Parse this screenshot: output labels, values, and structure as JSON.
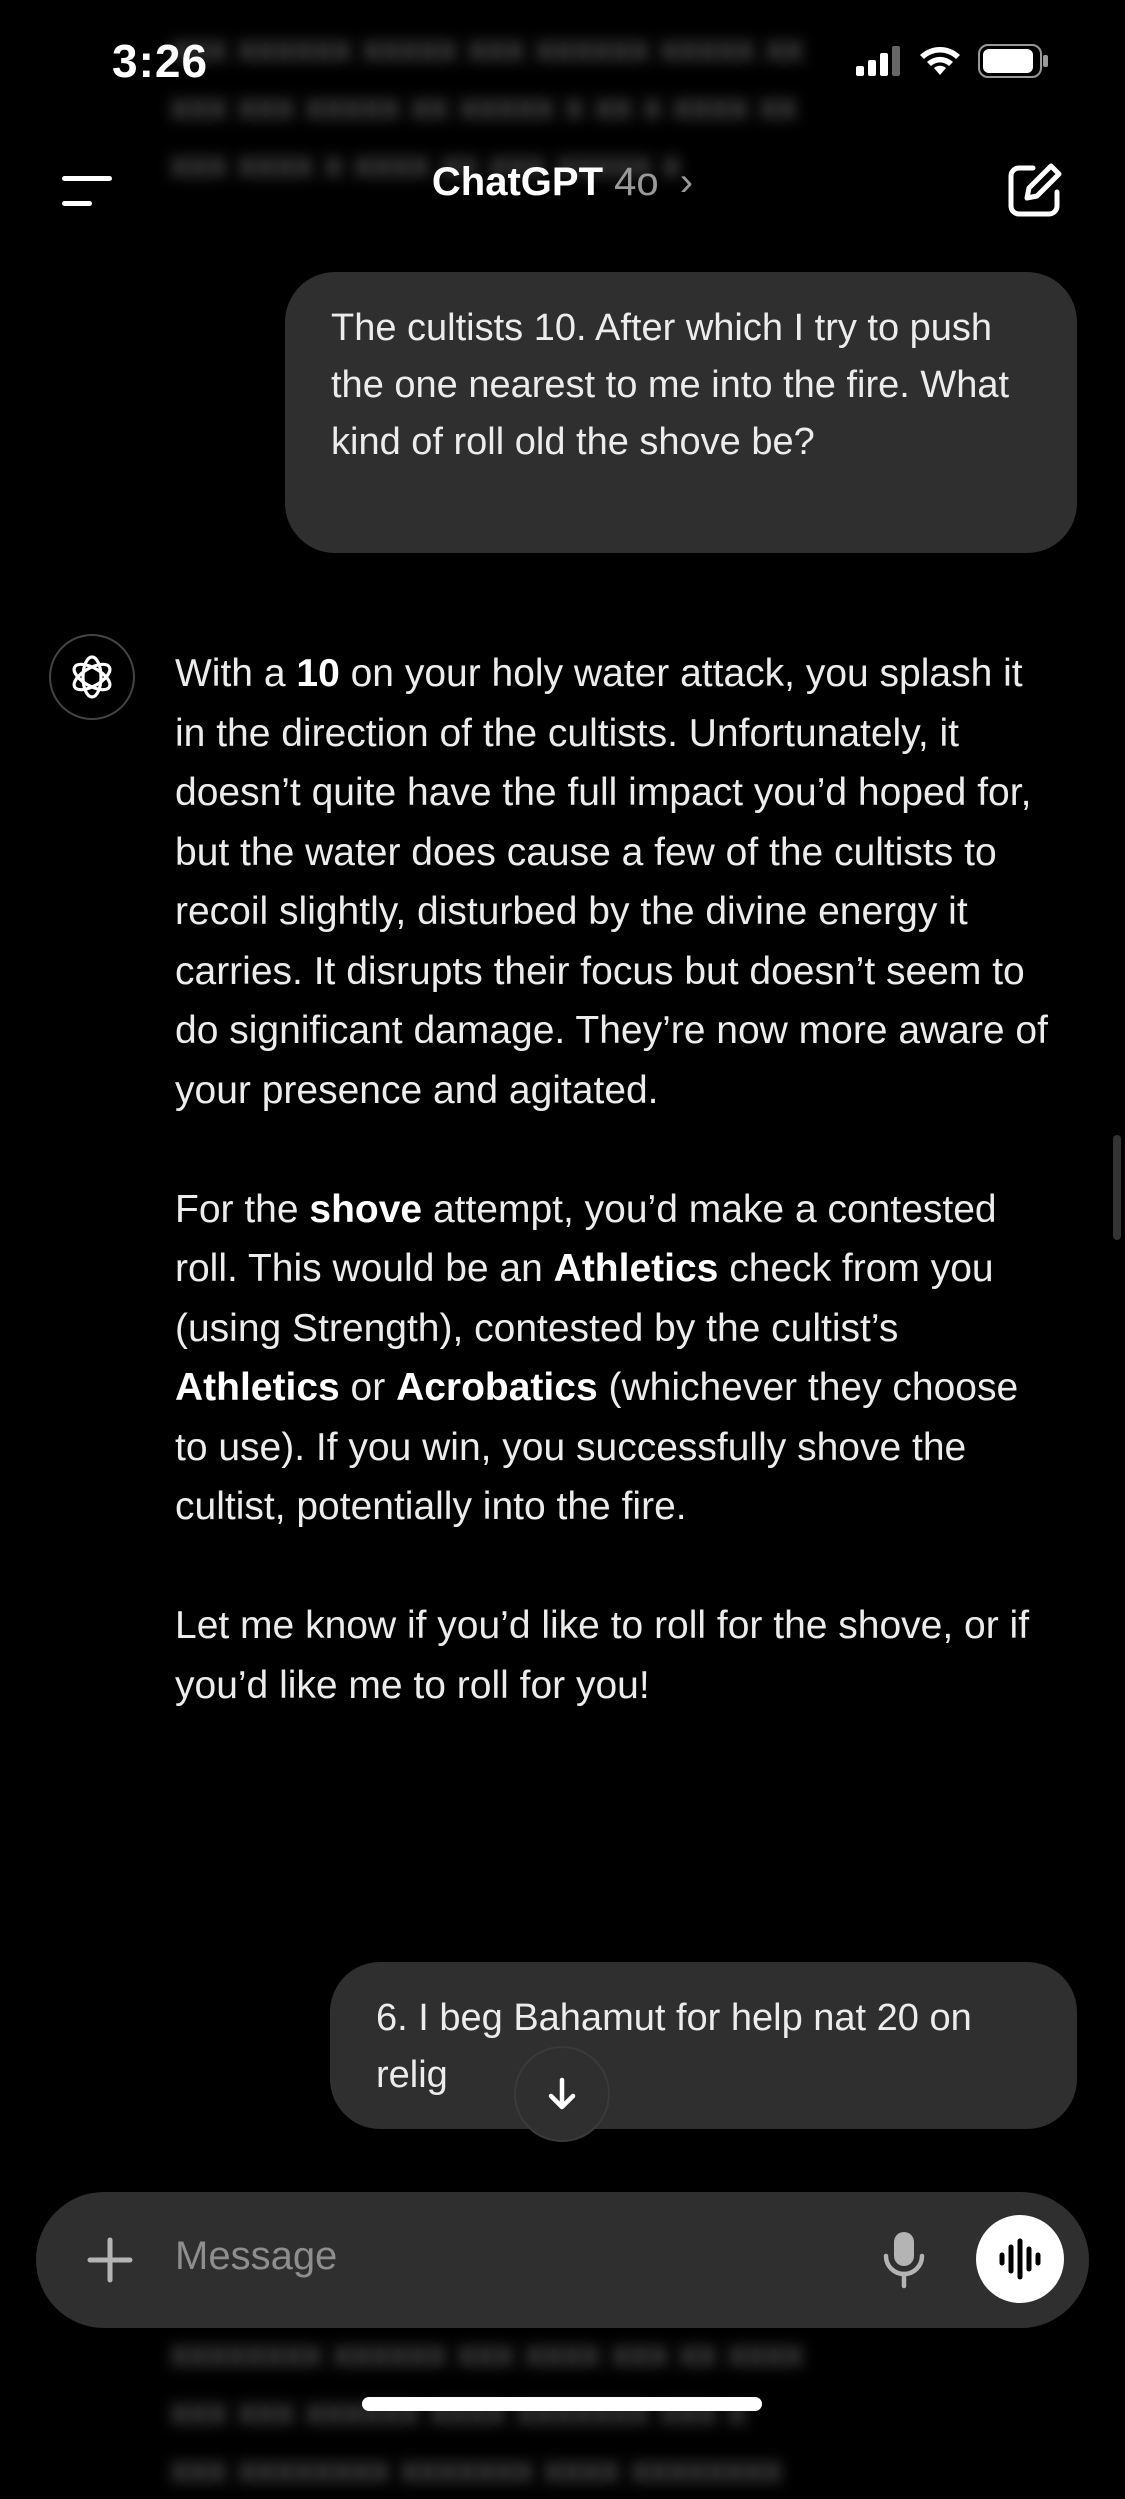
{
  "status": {
    "time": "3:26"
  },
  "header": {
    "title": "ChatGPT",
    "model": "4o",
    "chevron": "›"
  },
  "messages": {
    "user_1": "The cultists 10. After which I try to push the one nearest to me into the fire. What kind of roll old the shove be?",
    "assistant": {
      "p1_a": "With a ",
      "p1_b": "10",
      "p1_c": " on your holy water attack, you splash it in the direction of the cultists. Unfortunately, it doesn’t quite have the full impact you’d hoped for, but the water does cause a few of the cultists to recoil slightly, disturbed by the divine energy it carries. It disrupts their focus but doesn’t seem to do significant damage. They’re now more aware of your presence and agitated.",
      "p2_a": "For the ",
      "p2_b": "shove",
      "p2_c": " attempt, you’d make a contested roll. This would be an ",
      "p2_d": "Athletics",
      "p2_e": " check from you (using Strength), contested by the cultist’s ",
      "p2_f": "Athletics",
      "p2_g": " or ",
      "p2_h": "Acrobatics",
      "p2_i": " (whichever they choose to use). If you win, you successfully shove the cultist, potentially into the fire.",
      "p3": "Let me know if you’d like to roll for the shove, or if you’d like me to roll for you!"
    },
    "user_2": "6. I beg Bahamut for help nat 20 on relig"
  },
  "composer": {
    "placeholder": "Message"
  },
  "icons": {
    "menu": "menu-icon",
    "new_chat": "new-chat-icon",
    "assistant_logo": "openai-logo-icon",
    "scroll_down": "arrow-down-icon",
    "plus": "plus-icon",
    "mic": "microphone-icon",
    "voice": "voice-mode-icon"
  },
  "colors": {
    "background": "#000000",
    "bubble": "#2f2f2f",
    "text": "#ececec",
    "muted": "#8e8e8e"
  }
}
